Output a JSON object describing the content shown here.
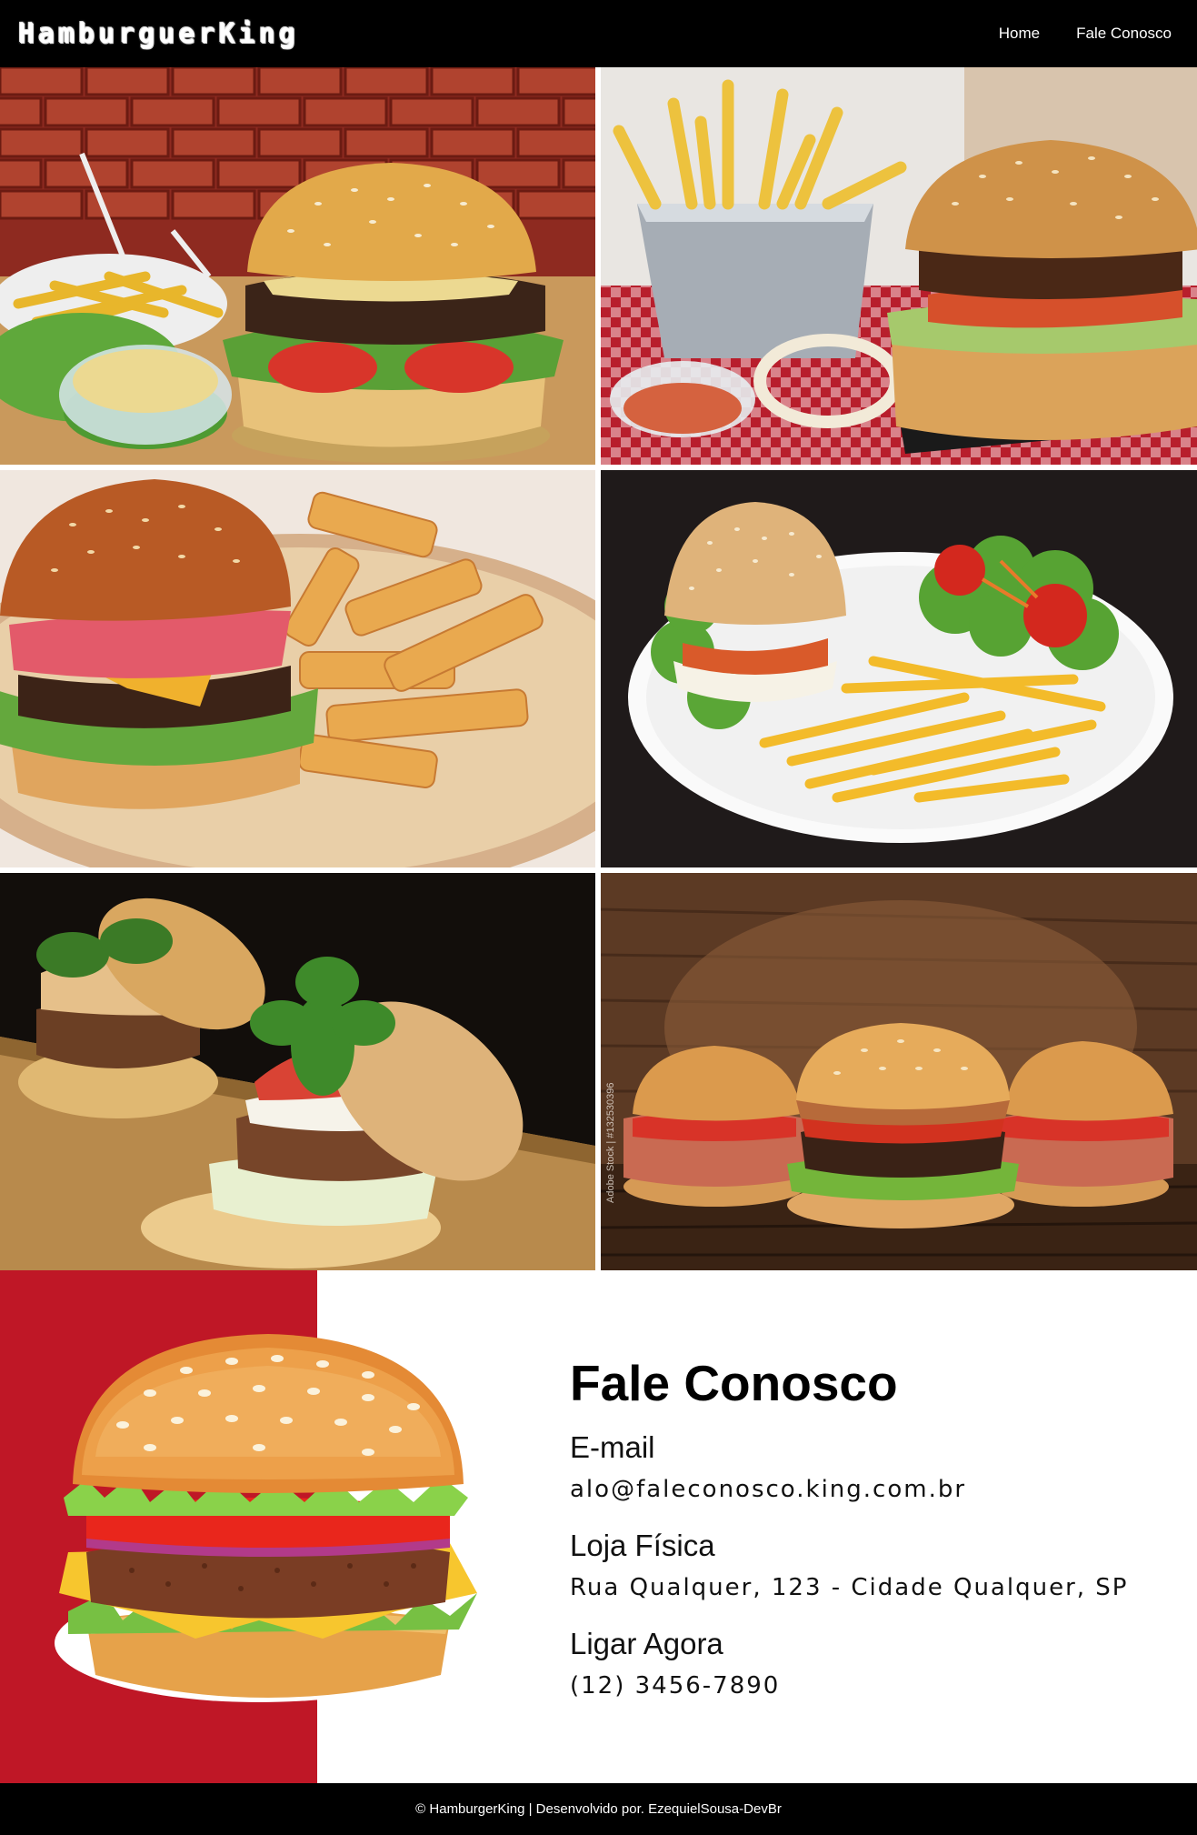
{
  "header": {
    "logo": "HamburguerKing",
    "nav": [
      {
        "label": "Home"
      },
      {
        "label": "Fale Conosco"
      }
    ]
  },
  "gallery": {
    "watermark": "Adobe Stock | #132530396"
  },
  "contact": {
    "title": "Fale Conosco",
    "items": [
      {
        "label": "E-mail",
        "value": "alo@faleconosco.king.com.br"
      },
      {
        "label": "Loja Física",
        "value": "Rua Qualquer, 123 - Cidade Qualquer, SP"
      },
      {
        "label": "Ligar Agora",
        "value": "(12) 3456-7890"
      }
    ]
  },
  "footer": {
    "text": "© HamburgerKing | Desenvolvido por. EzequielSousa-DevBr"
  },
  "colors": {
    "header_bg": "#000000",
    "accent_red": "#bf1726",
    "footer_bg": "#000000"
  }
}
